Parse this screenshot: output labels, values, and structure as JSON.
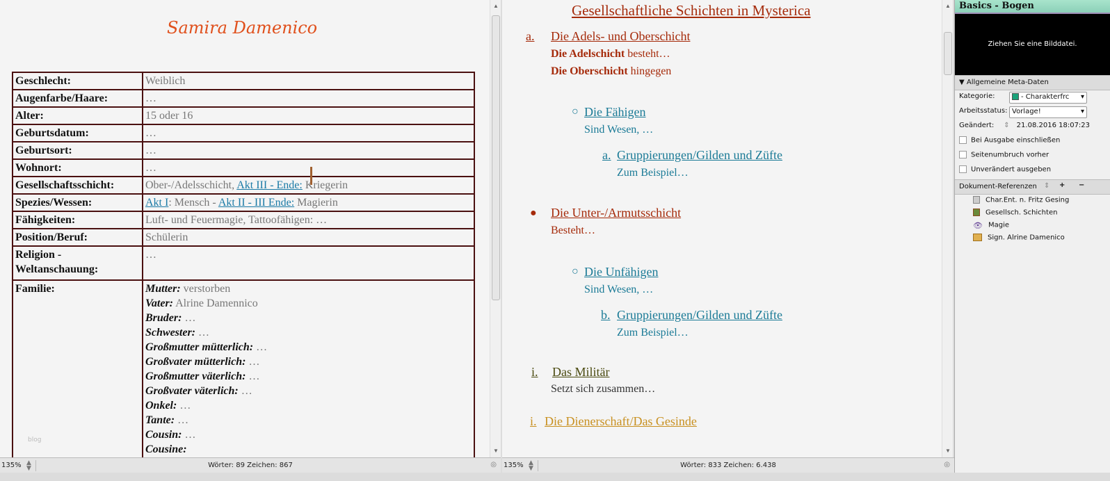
{
  "left": {
    "title": "Samira Damenico",
    "rows": [
      {
        "label": "Geschlecht:",
        "value": "Weiblich"
      },
      {
        "label": "Augenfarbe/Haare:",
        "value": "…"
      },
      {
        "label": "Alter:",
        "value": "15 oder 16"
      },
      {
        "label": "Geburtsdatum:",
        "value": "…"
      },
      {
        "label": "Geburtsort:",
        "value": "…"
      },
      {
        "label": "Wohnort:",
        "value": "…"
      },
      {
        "label": "Gesellschaftsschicht:",
        "value": "Ober-/Adelsschicht, ",
        "link": "Akt III - Ende:",
        "rest": " Kriegerin"
      },
      {
        "label": "Spezies/Wessen:",
        "link1": "Akt I",
        "mid": ": Mensch - ",
        "link2": "Akt II - III Ende:",
        "rest": " Magierin"
      },
      {
        "label": "Fähigkeiten:",
        "value": "Luft- und Feuermagie, Tattoofähigen: …"
      },
      {
        "label": "Position/Beruf:",
        "value": "Schülerin"
      },
      {
        "label": "Religion - Weltanschauung:",
        "value": "…"
      }
    ],
    "family_label": "Familie:",
    "family": [
      {
        "k": "Mutter:",
        "v": " verstorben"
      },
      {
        "k": "Vater:",
        "v": " Alrine Damennico"
      },
      {
        "k": "Bruder:",
        "v": " …"
      },
      {
        "k": "Schwester:",
        "v": " …"
      },
      {
        "k": "Großmutter mütterlich:",
        "v": " …"
      },
      {
        "k": "Großvater mütterlich:",
        "v": " …"
      },
      {
        "k": "Großmutter väterlich:",
        "v": " …"
      },
      {
        "k": "Großvater väterlich:",
        "v": " …"
      },
      {
        "k": "Onkel:",
        "v": " …"
      },
      {
        "k": "Tante:",
        "v": " …"
      },
      {
        "k": "Cousin:",
        "v": " …"
      },
      {
        "k": "Cousine:",
        "v": ""
      }
    ],
    "watermark": "blog",
    "status": {
      "zoom": "135%",
      "counts": "Wörter: 89   Zeichen: 867"
    }
  },
  "right": {
    "title": "Gesellschaftliche Schichten in Mysterica",
    "a_marker": "a.",
    "a_head": "Die Adels- und Oberschicht",
    "a1b": "Die Adelschicht",
    "a1": " besteht…",
    "a2b": "Die Oberschicht",
    "a2": " hingegen",
    "f_marker": "○",
    "f_head": "Die Fähigen",
    "f_text": "Sind Wesen, …",
    "g1_marker": "a.",
    "g1_head": "Gruppierungen/Gilden und Züfte",
    "g1_text": "Zum Beispiel…",
    "u_marker": "●",
    "u_head": "Die Unter-/Armutsschicht",
    "u_text": "Besteht…",
    "uf_marker": "○",
    "uf_head": "Die Unfähigen",
    "uf_text": "Sind Wesen, …",
    "g2_marker": "b.",
    "g2_head": "Gruppierungen/Gilden und Züfte",
    "g2_text": "Zum Beispiel…",
    "m_marker": "i.",
    "m_head": "Das Militär",
    "m_text": "Setzt sich zusammen…",
    "d_marker": "i.",
    "d_head": "Die Dienerschaft/Das Gesinde",
    "status": {
      "zoom": "135%",
      "counts": "Wörter: 833   Zeichen: 6.438"
    }
  },
  "inspector": {
    "title": "Basics - Bogen",
    "image_hint": "Ziehen Sie eine Bilddatei.",
    "meta_section": "Allgemeine Meta-Daten",
    "kategorie_label": "Kategorie:",
    "kategorie_value": "- Charakterfrc",
    "kategorie_color": "#1aa37a",
    "status_label": "Arbeitsstatus:",
    "status_value": "Vorlage!",
    "changed_label": "Geändert:",
    "changed_value": "21.08.2016 18:07:23",
    "checks": [
      "Bei Ausgabe einschließen",
      "Seitenumbruch vorher",
      "Unverändert ausgeben"
    ],
    "refs_label": "Dokument-Referenzen",
    "add": "+",
    "remove": "−",
    "refs": [
      "Char.Ent. n. Fritz Gesing",
      "Gesellsch. Schichten",
      "Magie",
      "Sign. Alrine Damenico"
    ]
  }
}
